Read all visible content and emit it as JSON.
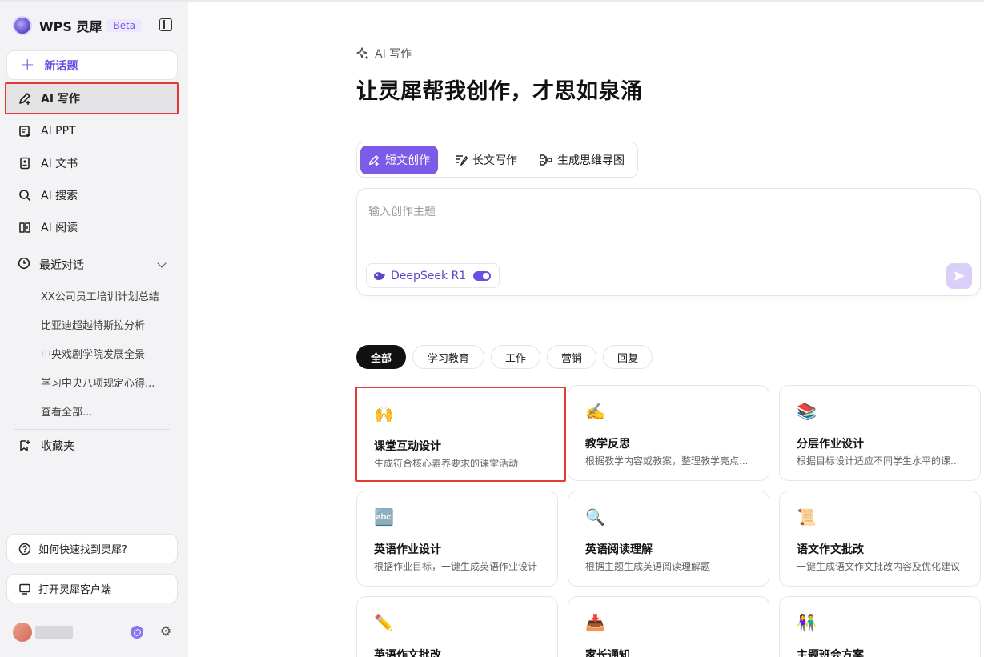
{
  "brand": {
    "name": "WPS 灵犀",
    "badge": "Beta"
  },
  "sidebar": {
    "new_topic": "新话题",
    "items": [
      {
        "label": "AI 写作",
        "icon": "pen-sparkle-icon",
        "active": true
      },
      {
        "label": "AI PPT",
        "icon": "ppt-icon"
      },
      {
        "label": "AI 文书",
        "icon": "document-icon"
      },
      {
        "label": "AI 搜索",
        "icon": "search-icon"
      },
      {
        "label": "AI 阅读",
        "icon": "book-icon"
      }
    ],
    "recent": {
      "label": "最近对话",
      "items": [
        "XX公司员工培训计划总结",
        "比亚迪超越特斯拉分析",
        "中央戏剧学院发展全景",
        "学习中央八项规定心得...",
        "查看全部..."
      ]
    },
    "favorites": "收藏夹",
    "help": "如何快速找到灵犀?",
    "open_client": "打开灵犀客户端"
  },
  "main": {
    "breadcrumb": "AI 写作",
    "title": "让灵犀帮我创作，才思如泉涌",
    "modes": [
      "短文创作",
      "长文写作",
      "生成思维导图"
    ],
    "input": {
      "placeholder": "输入创作主题",
      "model": "DeepSeek R1",
      "model_enabled": true
    },
    "filters": [
      "全部",
      "学习教育",
      "工作",
      "营销",
      "回复"
    ],
    "cards": [
      {
        "emoji": "🙌",
        "title": "课堂互动设计",
        "desc": "生成符合核心素养要求的课堂活动"
      },
      {
        "emoji": "✍️",
        "title": "教学反思",
        "desc": "根据教学内容或教案，整理教学亮点..."
      },
      {
        "emoji": "📚",
        "title": "分层作业设计",
        "desc": "根据目标设计适应不同学生水平的课..."
      },
      {
        "emoji": "🔤",
        "title": "英语作业设计",
        "desc": "根据作业目标，一键生成英语作业设计"
      },
      {
        "emoji": "🔍",
        "title": "英语阅读理解",
        "desc": "根据主题生成英语阅读理解题"
      },
      {
        "emoji": "📜",
        "title": "语文作文批改",
        "desc": "一键生成语文作文批改内容及优化建议"
      },
      {
        "emoji": "✏️",
        "title": "英语作文批改",
        "desc": ""
      },
      {
        "emoji": "📥",
        "title": "家长通知",
        "desc": ""
      },
      {
        "emoji": "👫",
        "title": "主题班会方案",
        "desc": ""
      }
    ]
  },
  "colors": {
    "accent": "#7b5ce9",
    "highlight": "#e53935"
  }
}
